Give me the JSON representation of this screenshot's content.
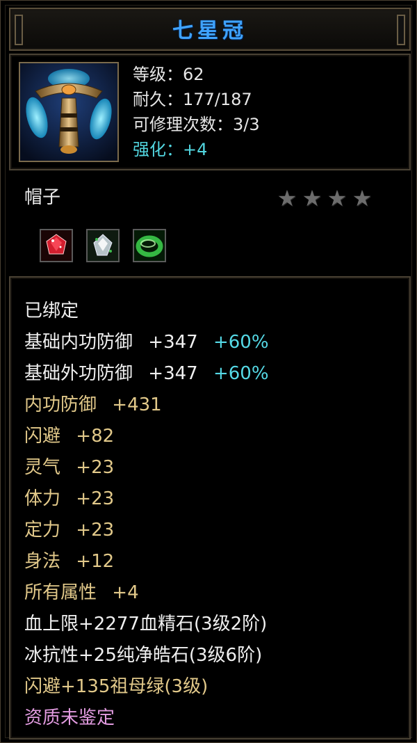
{
  "item": {
    "name": "七星冠",
    "level_text": "等级：62",
    "durability_text": "耐久：177/187",
    "repair_text": "可修理次数：3/3",
    "enhance_text": "强化：+4",
    "type": "帽子",
    "star_count": 4,
    "gems": [
      {
        "icon": "red-gem-icon",
        "color": "#c0192a"
      },
      {
        "icon": "white-gem-icon",
        "color": "#cfd7dc"
      },
      {
        "icon": "green-ring-gem-icon",
        "color": "#2fa43a"
      }
    ]
  },
  "attributes": {
    "bound": "已绑定",
    "inner_def_base": {
      "label": "基础内功防御",
      "value": "+347",
      "bonus": "+60%"
    },
    "outer_def_base": {
      "label": "基础外功防御",
      "value": "+347",
      "bonus": "+60%"
    },
    "inner_def": {
      "label": "内功防御",
      "value": "+431"
    },
    "dodge": {
      "label": "闪避",
      "value": "+82"
    },
    "spirit": {
      "label": "灵气",
      "value": "+23"
    },
    "stamina": {
      "label": "体力",
      "value": "+23"
    },
    "focus": {
      "label": "定力",
      "value": "+23"
    },
    "agility": {
      "label": "身法",
      "value": "+12"
    },
    "all_attr": {
      "label": "所有属性",
      "value": "+4"
    },
    "socket_1": "血上限+2277血精石(3级2阶)",
    "socket_2": "冰抗性+25纯净皓石(3级6阶)",
    "socket_3": "闪避+135祖母绿(3级)",
    "quality": "资质未鉴定"
  },
  "colors": {
    "title": "#3fa3ff",
    "white_text": "#f0f0f0",
    "gold_text": "#e2c98a",
    "cyan_text": "#55d9e6",
    "pink_text": "#e29be0"
  }
}
